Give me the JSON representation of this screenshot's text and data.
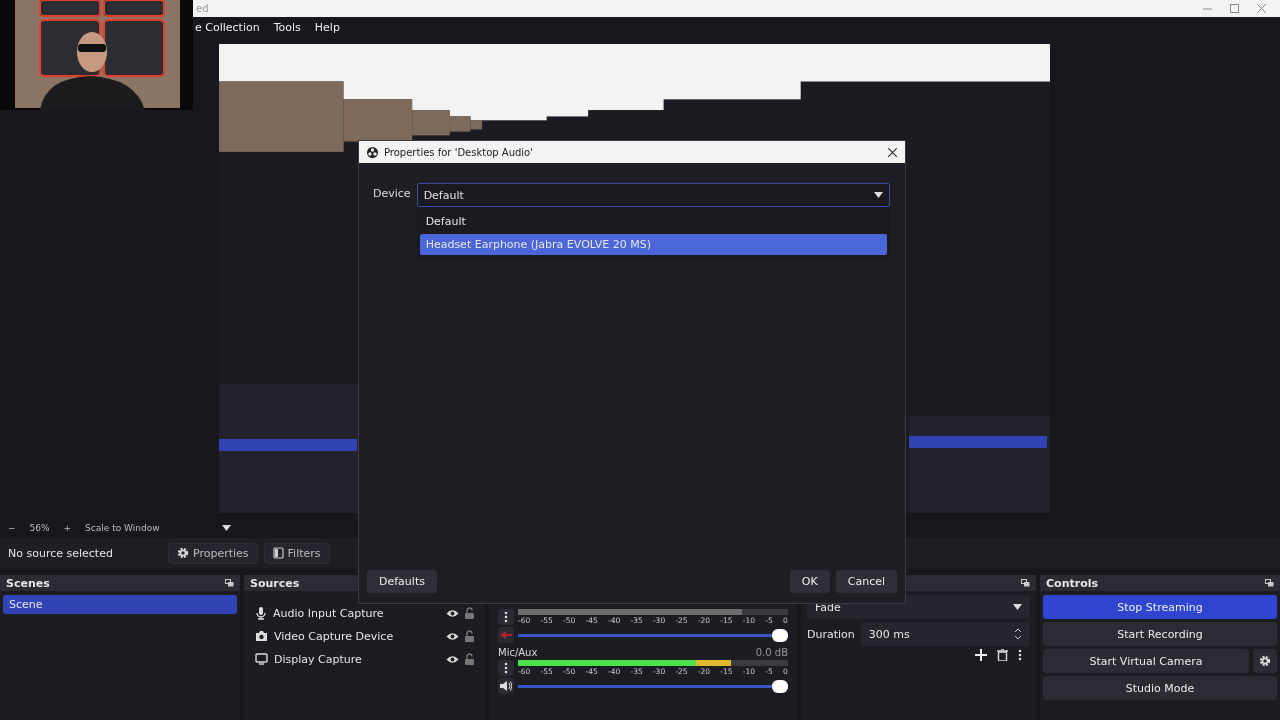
{
  "title_bar": {
    "title": "ed"
  },
  "menu": [
    "e Collection",
    "Tools",
    "Help"
  ],
  "zoom_bar": {
    "minus": "−",
    "zoom": "56%",
    "plus": "+",
    "scale": "Scale to Window"
  },
  "source_toolbar": {
    "status": "No source selected",
    "buttons": [
      {
        "kind": "gear",
        "label": "Properties"
      },
      {
        "kind": "filter",
        "label": "Filters"
      }
    ]
  },
  "scenes": {
    "title": "Scenes",
    "items": [
      {
        "label": "Scene",
        "selected": true
      }
    ]
  },
  "sources": {
    "title": "Sources",
    "items": [
      {
        "kind": "mic",
        "label": "Audio Input Capture",
        "visible": true,
        "locked": false
      },
      {
        "kind": "camera",
        "label": "Video Capture Device",
        "visible": true,
        "locked": false
      },
      {
        "kind": "display",
        "label": "Display Capture",
        "visible": true,
        "locked": false
      }
    ]
  },
  "audio_mixer": {
    "channels": [
      {
        "muted": true,
        "meter": {
          "level": 0.83
        },
        "ticks": [
          "-60",
          "-55",
          "-50",
          "-45",
          "-40",
          "-35",
          "-30",
          "-25",
          "-20",
          "-15",
          "-10",
          "-5",
          "0"
        ],
        "volume": {
          "level": 1
        }
      },
      {
        "name": "Mic/Aux",
        "reading": "0.0 dB",
        "muted": false,
        "meter": {
          "level": 0.79
        },
        "ticks": [
          "-60",
          "-55",
          "-50",
          "-45",
          "-40",
          "-35",
          "-30",
          "-25",
          "-20",
          "-15",
          "-10",
          "-5",
          "0"
        ],
        "volume": {
          "level": 1
        }
      }
    ]
  },
  "transitions": {
    "type": "Fade",
    "duration_label": "Duration",
    "duration": "300 ms"
  },
  "controls": {
    "title": "Controls",
    "buttons": [
      {
        "label": "Stop Streaming",
        "active": true,
        "settings": false
      },
      {
        "label": "Start Recording",
        "active": false,
        "settings": false
      },
      {
        "label": "Start Virtual Camera",
        "active": false,
        "settings": true
      },
      {
        "label": "Studio Mode",
        "active": false,
        "settings": false
      }
    ]
  },
  "dialog": {
    "title": "Properties for 'Desktop Audio'",
    "device_label": "Device",
    "device_value": "Default",
    "options": [
      {
        "label": "Default",
        "selected": false
      },
      {
        "label": "Headset Earphone (Jabra EVOLVE 20 MS)",
        "selected": true
      }
    ],
    "buttons": [
      "Defaults",
      "OK",
      "Cancel"
    ]
  }
}
